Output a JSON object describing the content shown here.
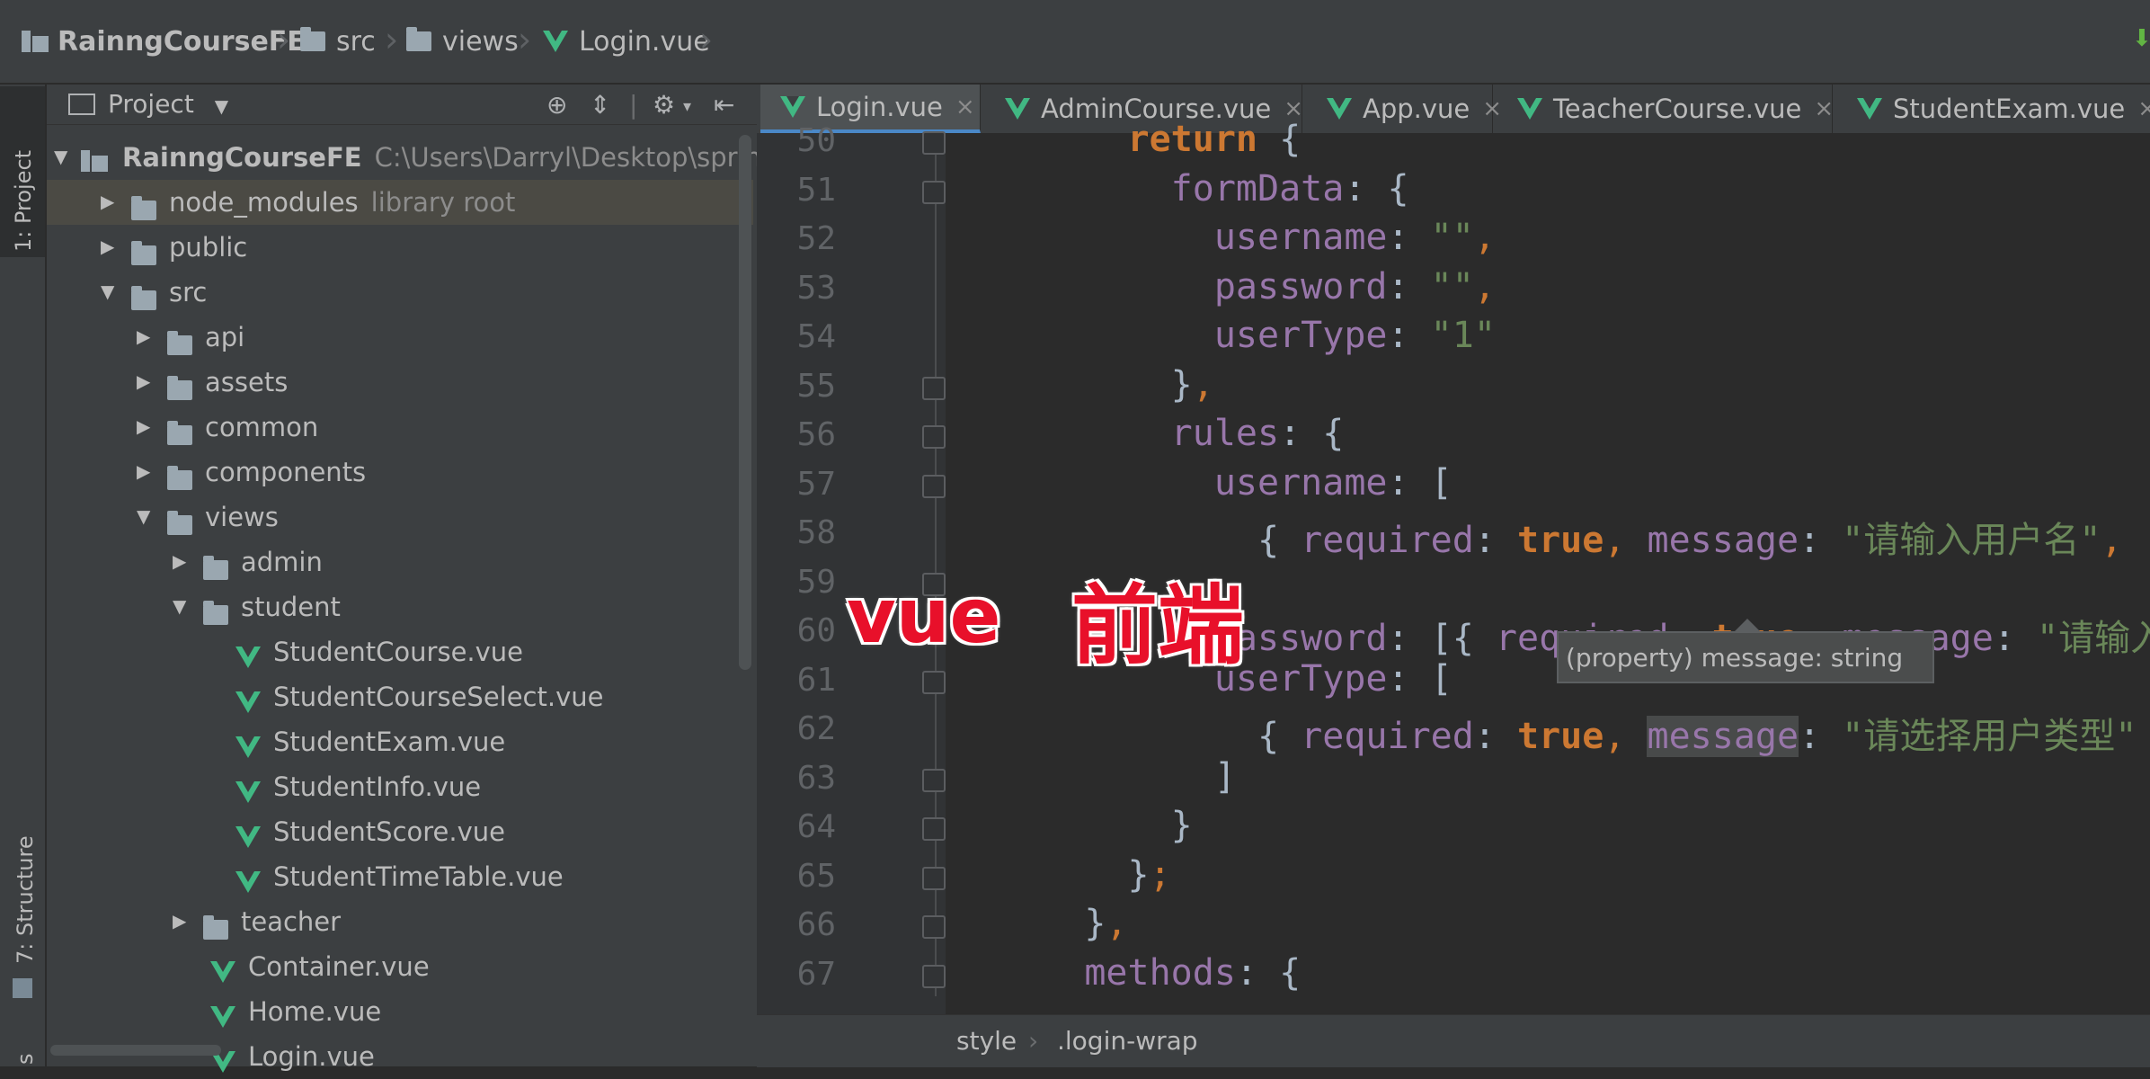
{
  "breadcrumbs": [
    "RainngCourseFE",
    "src",
    "views",
    "Login.vue"
  ],
  "project_panel": {
    "title": "Project",
    "stripe_project_label": "1: Project",
    "stripe_structure_label": "7: Structure",
    "stripe_bottom_label": "s",
    "tree": [
      {
        "label": "RainngCourseFE",
        "hint": "C:\\Users\\Darryl\\Desktop\\springb",
        "type": "project",
        "depth": 0,
        "expanded": true
      },
      {
        "label": "node_modules",
        "hint": "library root",
        "type": "folder",
        "depth": 1,
        "expanded": false
      },
      {
        "label": "public",
        "hint": "",
        "type": "folder",
        "depth": 1,
        "expanded": false
      },
      {
        "label": "src",
        "hint": "",
        "type": "folder",
        "depth": 1,
        "expanded": true
      },
      {
        "label": "api",
        "hint": "",
        "type": "folder",
        "depth": 2,
        "expanded": false
      },
      {
        "label": "assets",
        "hint": "",
        "type": "folder",
        "depth": 2,
        "expanded": false
      },
      {
        "label": "common",
        "hint": "",
        "type": "folder",
        "depth": 2,
        "expanded": false
      },
      {
        "label": "components",
        "hint": "",
        "type": "folder",
        "depth": 2,
        "expanded": false
      },
      {
        "label": "views",
        "hint": "",
        "type": "folder",
        "depth": 2,
        "expanded": true
      },
      {
        "label": "admin",
        "hint": "",
        "type": "folder",
        "depth": 3,
        "expanded": false
      },
      {
        "label": "student",
        "hint": "",
        "type": "folder",
        "depth": 3,
        "expanded": true
      },
      {
        "label": "StudentCourse.vue",
        "hint": "",
        "type": "vue",
        "depth": 4
      },
      {
        "label": "StudentCourseSelect.vue",
        "hint": "",
        "type": "vue",
        "depth": 4
      },
      {
        "label": "StudentExam.vue",
        "hint": "",
        "type": "vue",
        "depth": 4
      },
      {
        "label": "StudentInfo.vue",
        "hint": "",
        "type": "vue",
        "depth": 4
      },
      {
        "label": "StudentScore.vue",
        "hint": "",
        "type": "vue",
        "depth": 4
      },
      {
        "label": "StudentTimeTable.vue",
        "hint": "",
        "type": "vue",
        "depth": 4
      },
      {
        "label": "teacher",
        "hint": "",
        "type": "folder",
        "depth": 3,
        "expanded": false
      },
      {
        "label": "Container.vue",
        "hint": "",
        "type": "vue",
        "depth": 3
      },
      {
        "label": "Home.vue",
        "hint": "",
        "type": "vue",
        "depth": 3
      },
      {
        "label": "Login.vue",
        "hint": "",
        "type": "vue",
        "depth": 3
      }
    ]
  },
  "editor_tabs": [
    {
      "label": "Login.vue",
      "active": true
    },
    {
      "label": "AdminCourse.vue",
      "active": false
    },
    {
      "label": "App.vue",
      "active": false
    },
    {
      "label": "TeacherCourse.vue",
      "active": false
    },
    {
      "label": "StudentExam.vue",
      "active": false
    }
  ],
  "code_lines": [
    {
      "n": "50",
      "tokens": [
        [
          "kw",
          "      return"
        ],
        [
          "pun",
          " {"
        ]
      ]
    },
    {
      "n": "51",
      "tokens": [
        [
          "prop",
          "        formData"
        ],
        [
          "pun",
          ": {"
        ]
      ]
    },
    {
      "n": "52",
      "tokens": [
        [
          "prop",
          "          username"
        ],
        [
          "pun",
          ": "
        ],
        [
          "str",
          "\"\""
        ],
        [
          "com",
          ","
        ]
      ]
    },
    {
      "n": "53",
      "tokens": [
        [
          "prop",
          "          password"
        ],
        [
          "pun",
          ": "
        ],
        [
          "str",
          "\"\""
        ],
        [
          "com",
          ","
        ]
      ]
    },
    {
      "n": "54",
      "tokens": [
        [
          "prop",
          "          userType"
        ],
        [
          "pun",
          ": "
        ],
        [
          "str",
          "\"1\""
        ]
      ]
    },
    {
      "n": "55",
      "tokens": [
        [
          "pun",
          "        }"
        ],
        [
          "com",
          ","
        ]
      ]
    },
    {
      "n": "56",
      "tokens": [
        [
          "prop",
          "        rules"
        ],
        [
          "pun",
          ": {"
        ]
      ]
    },
    {
      "n": "57",
      "tokens": [
        [
          "prop",
          "          username"
        ],
        [
          "pun",
          ": ["
        ]
      ]
    },
    {
      "n": "58",
      "tokens": [
        [
          "pun",
          "            { "
        ],
        [
          "prop",
          "required"
        ],
        [
          "pun",
          ": "
        ],
        [
          "kw",
          "true"
        ],
        [
          "com",
          ", "
        ],
        [
          "prop",
          "message"
        ],
        [
          "pun",
          ": "
        ],
        [
          "str",
          "\"请输入用户名\""
        ],
        [
          "com",
          ","
        ]
      ]
    },
    {
      "n": "59",
      "tokens": [
        [
          "pun",
          "          "
        ]
      ]
    },
    {
      "n": "60",
      "tokens": [
        [
          "pun",
          "          "
        ],
        [
          "prop",
          "password"
        ],
        [
          "pun",
          ": [{ "
        ],
        [
          "prop",
          "required"
        ],
        [
          "pun",
          ": "
        ],
        [
          "kw",
          "true"
        ],
        [
          "com",
          ", "
        ],
        [
          "prop",
          "message"
        ],
        [
          "pun",
          ": "
        ],
        [
          "str",
          "\"请输入"
        ]
      ]
    },
    {
      "n": "61",
      "tokens": [
        [
          "prop",
          "          userType"
        ],
        [
          "pun",
          ": ["
        ]
      ]
    },
    {
      "n": "62",
      "tokens": [
        [
          "pun",
          "            { "
        ],
        [
          "prop",
          "required"
        ],
        [
          "pun",
          ": "
        ],
        [
          "kw",
          "true"
        ],
        [
          "com",
          ", "
        ],
        [
          "prop hl",
          "message"
        ],
        [
          "pun",
          ": "
        ],
        [
          "str",
          "\"请选择用户类型\""
        ]
      ]
    },
    {
      "n": "63",
      "tokens": [
        [
          "pun",
          "          ]"
        ]
      ]
    },
    {
      "n": "64",
      "tokens": [
        [
          "pun",
          "        }"
        ]
      ]
    },
    {
      "n": "65",
      "tokens": [
        [
          "pun",
          "      }"
        ],
        [
          "com",
          ";"
        ]
      ]
    },
    {
      "n": "66",
      "tokens": [
        [
          "pun",
          "    }"
        ],
        [
          "com",
          ","
        ]
      ]
    },
    {
      "n": "67",
      "tokens": [
        [
          "prop",
          "    methods"
        ],
        [
          "pun",
          ": {"
        ]
      ]
    }
  ],
  "tooltip": "(property) message: string",
  "overlay": {
    "left": "vue",
    "right": "前端"
  },
  "editor_breadcrumb": [
    "style",
    ".login-wrap"
  ],
  "colors": {
    "vue_green": "#41b883",
    "keyword": "#cc7832",
    "property": "#9876aa",
    "string": "#6a8759",
    "overlay_red": "#e8102a"
  }
}
